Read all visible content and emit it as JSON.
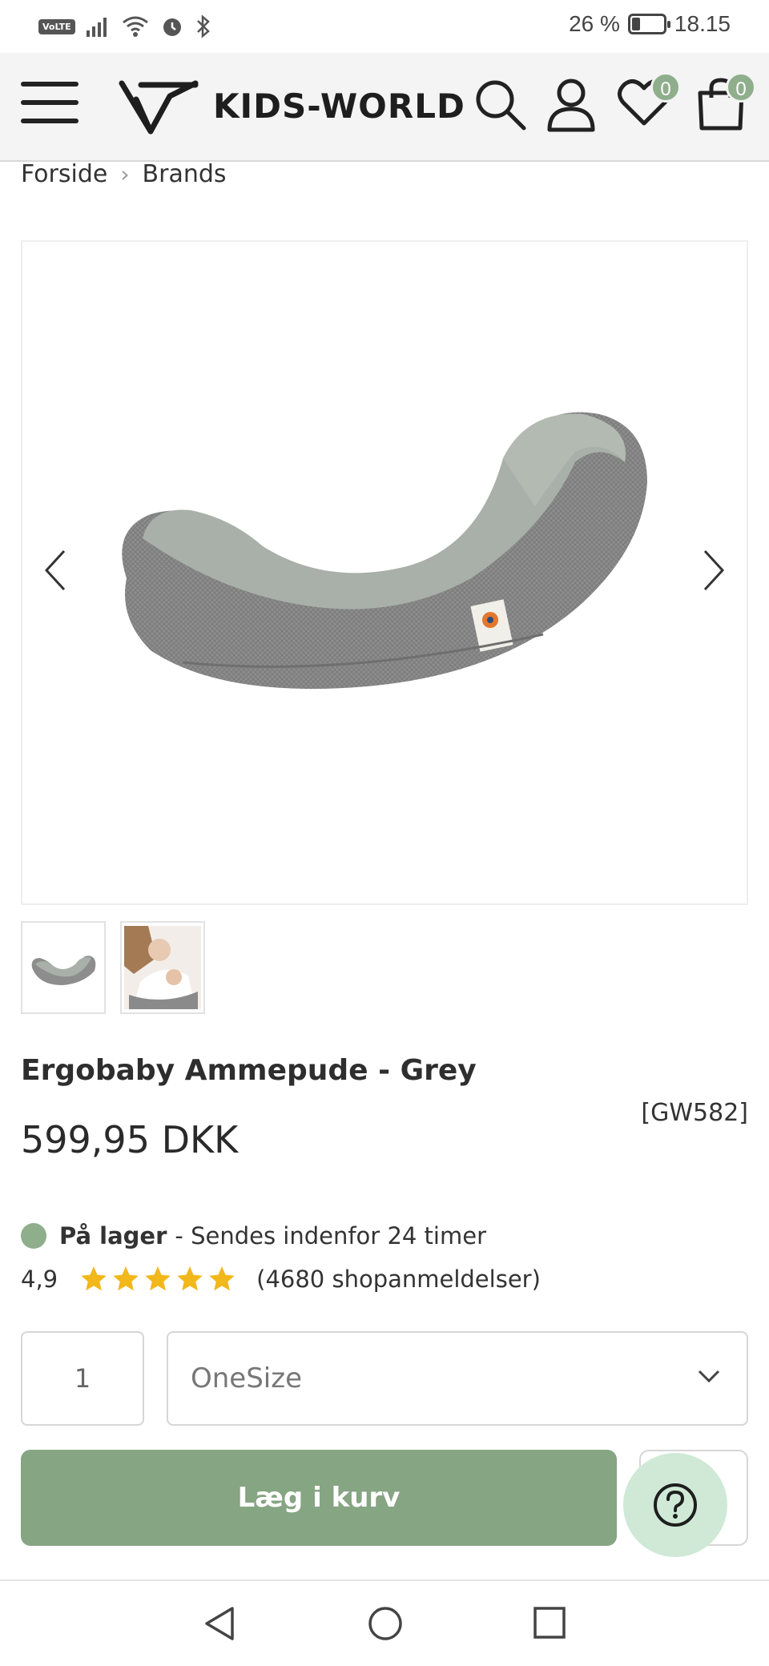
{
  "status_bar": {
    "network_label": "VoLTE",
    "battery_text": "26 %",
    "battery_level": 0.26,
    "time": "18.15"
  },
  "header": {
    "logo_text": "KIDS-WORLD",
    "wishlist_count": "0",
    "cart_count": "0"
  },
  "breadcrumb": {
    "items": [
      "Forside",
      "Brands"
    ]
  },
  "product": {
    "title": "Ergobaby Ammepude - Grey",
    "sku": "[GW582]",
    "price": "599,95 DKK",
    "stock_status": "På lager",
    "shipping_note": "- Sendes indenfor 24 timer",
    "rating_score": "4,9",
    "rating_stars": 5,
    "review_count_text": "(4680 shopanmeldelser)",
    "image_count": 2
  },
  "controls": {
    "quantity": "1",
    "size_selected": "OneSize",
    "add_to_cart_label": "Læg i kurv"
  },
  "colors": {
    "accent_green": "#86a583",
    "badge_green": "#8fae8c",
    "star_yellow": "#f2b71a",
    "help_bg": "#cfe9d6"
  }
}
